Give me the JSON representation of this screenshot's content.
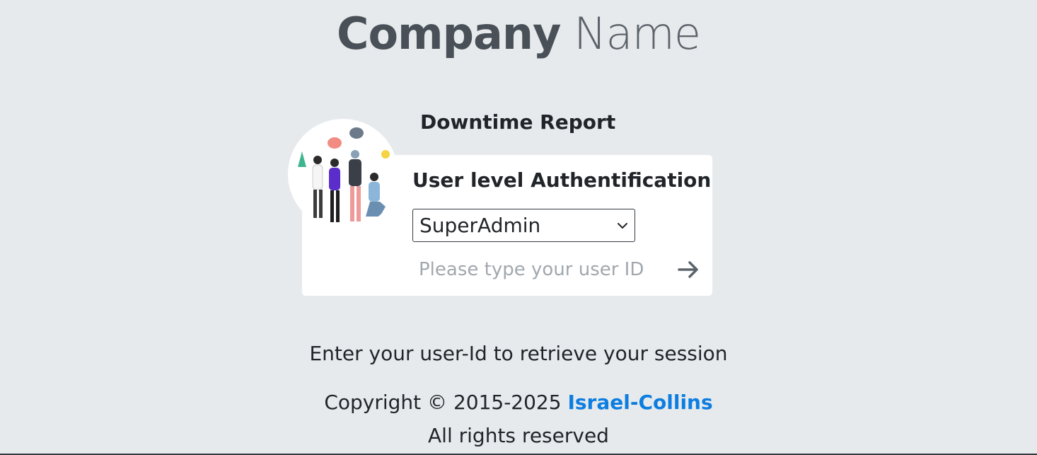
{
  "brand": {
    "word1": "Company",
    "word2": "Name"
  },
  "report": {
    "title": "Downtime Report"
  },
  "auth": {
    "title": "User level Authentification",
    "level_selected": "SuperAdmin",
    "userid_placeholder": "Please type your user ID",
    "submit_icon": "arrow-right-icon"
  },
  "footer": {
    "hint": "Enter your user-Id to retrieve your session",
    "copyright_prefix": "Copyright © 2015-2025",
    "company_link": "Israel-Collins",
    "rights": "All rights reserved"
  },
  "colors": {
    "background": "#e7eaed",
    "card": "#ffffff",
    "link": "#0d7ee0"
  }
}
